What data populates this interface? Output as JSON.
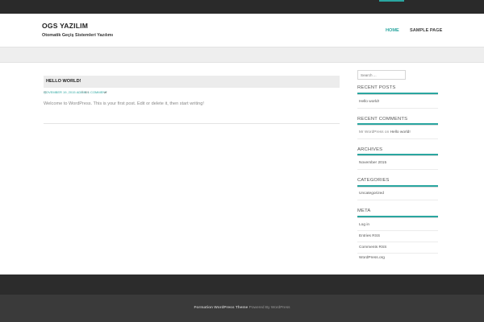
{
  "site": {
    "title": "OGS YAZILIM",
    "description": "Otomatik Geçiş Sistemleri Yazılımı"
  },
  "nav": {
    "home": "HOME",
    "sample_page": "SAMPLE PAGE"
  },
  "post": {
    "title": "HELLO WORLD!",
    "date": "NOVEMBER 19, 2015",
    "by": "BY",
    "author": "ADMIN",
    "comments": "1 COMMENT",
    "content": "Welcome to WordPress. This is your first post. Edit or delete it, then start writing!"
  },
  "sidebar": {
    "search_placeholder": "Search ...",
    "recent_posts": {
      "title": "RECENT POSTS",
      "items": [
        "Hello world!"
      ]
    },
    "recent_comments": {
      "title": "RECENT COMMENTS",
      "author": "Mr WordPress",
      "on": "on",
      "post": "Hello world!"
    },
    "archives": {
      "title": "ARCHIVES",
      "items": [
        "November 2015"
      ]
    },
    "categories": {
      "title": "CATEGORIES",
      "items": [
        "Uncategorized"
      ]
    },
    "meta": {
      "title": "META",
      "items": [
        "Log in",
        "Entries RSS",
        "Comments RSS",
        "WordPress.org"
      ]
    }
  },
  "footer": {
    "theme_name": "Formation WordPress Theme",
    "powered_by": "Powered By WordPress"
  },
  "colors": {
    "accent": "#2aa6a0",
    "topbar": "#2a2a2a",
    "footer_top": "#2c2c2c",
    "footer_bottom": "#3a3a3a"
  }
}
